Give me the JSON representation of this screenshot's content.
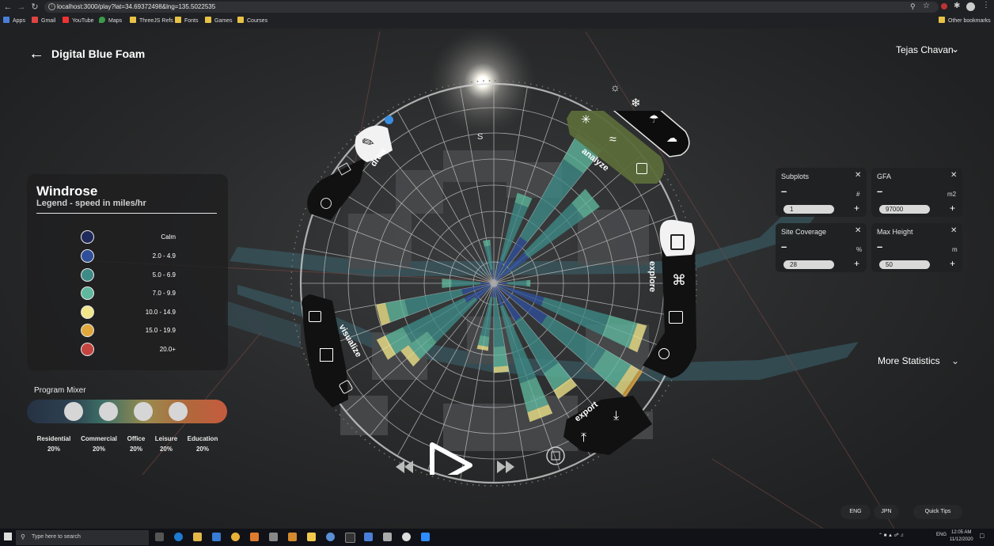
{
  "browser": {
    "url": "localhost:3000/play?lat=34.69372498&lng=135.5022535",
    "bookmarks": [
      "Apps",
      "Gmail",
      "YouTube",
      "Maps",
      "ThreeJS Refs",
      "Fonts",
      "Games",
      "Courses"
    ],
    "other_bookmarks": "Other bookmarks"
  },
  "header": {
    "title": "Digital Blue Foam",
    "user": "Tejas Chavan"
  },
  "compass": {
    "south": "S"
  },
  "radial_menu": {
    "draw": "draw",
    "analyze": "analyze",
    "explore": "explore",
    "visualize": "visualize",
    "export": "export"
  },
  "windrose": {
    "title": "Windrose",
    "subtitle": "Legend - speed in miles/hr",
    "legend": [
      {
        "label": "Calm",
        "color": "#1f2a5a"
      },
      {
        "label": "2.0 - 4.9",
        "color": "#2f4f9a"
      },
      {
        "label": "5.0 - 6.9",
        "color": "#3e8a86"
      },
      {
        "label": "7.0 - 9.9",
        "color": "#5fb89e"
      },
      {
        "label": "10.0 - 14.9",
        "color": "#f1e68a"
      },
      {
        "label": "15.0 - 19.9",
        "color": "#e0a73c"
      },
      {
        "label": "20.0+",
        "color": "#c4443f"
      }
    ]
  },
  "program_mixer": {
    "title": "Program Mixer",
    "items": [
      {
        "name": "Residential",
        "pct": "20%"
      },
      {
        "name": "Commercial",
        "pct": "20%"
      },
      {
        "name": "Office",
        "pct": "20%"
      },
      {
        "name": "Leisure",
        "pct": "20%"
      },
      {
        "name": "Education",
        "pct": "20%"
      }
    ]
  },
  "stats": {
    "cards": [
      {
        "title": "Subplots",
        "unit": "#",
        "value": "1"
      },
      {
        "title": "GFA",
        "unit": "m2",
        "value": "97000"
      },
      {
        "title": "Site Coverage",
        "unit": "%",
        "value": "28"
      },
      {
        "title": "Max Height",
        "unit": "m",
        "value": "50"
      }
    ],
    "more": "More Statistics"
  },
  "footer_buttons": {
    "eng": "ENG",
    "jpn": "JPN",
    "tips": "Quick Tips"
  },
  "taskbar": {
    "search_placeholder": "Type here to search",
    "lang": "ENG",
    "time": "12:05 AM",
    "date": "11/12/2020"
  }
}
